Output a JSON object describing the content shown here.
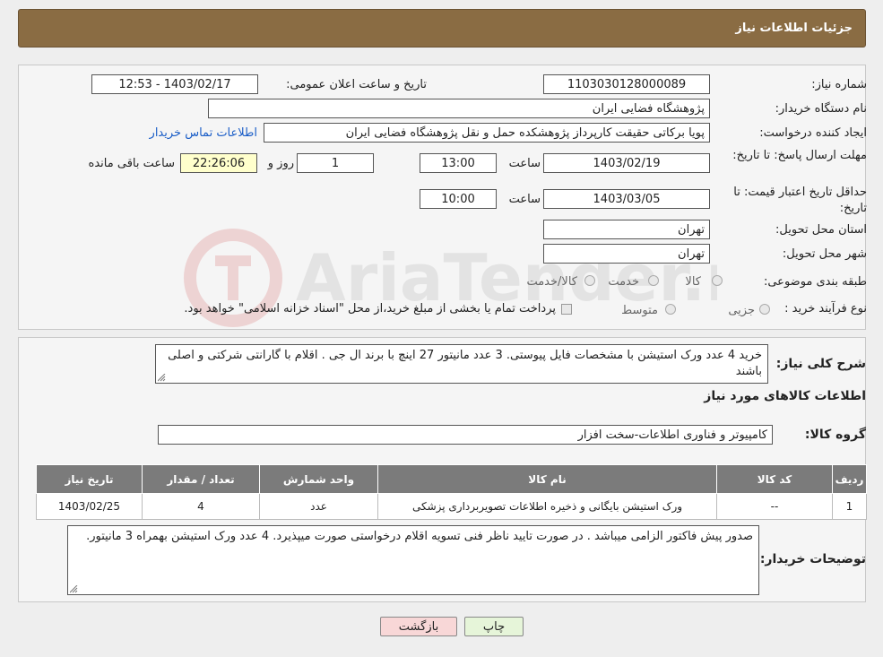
{
  "header": {
    "title": "جزئیات اطلاعات نیاز"
  },
  "form": {
    "need_number_label": "شماره نیاز:",
    "need_number": "1103030128000089",
    "announce_label": "تاریخ و ساعت اعلان عمومی:",
    "announce_value": "1403/02/17 - 12:53",
    "buyer_org_label": "نام دستگاه خریدار:",
    "buyer_org": "پژوهشگاه فضایی ایران",
    "creator_label": "ایجاد کننده درخواست:",
    "creator": "پویا برکاتی حقیقت کارپرداز پژوهشکده حمل و نقل پژوهشگاه فضایی ایران",
    "contact_link": "اطلاعات تماس خریدار",
    "deadline_label": "مهلت ارسال پاسخ: تا تاریخ:",
    "deadline_date": "1403/02/19",
    "time_label": "ساعت",
    "deadline_time": "13:00",
    "days_value": "1",
    "days_label": "روز و",
    "remaining_time": "22:26:06",
    "remaining_label": "ساعت باقی مانده",
    "validity_label": "حداقل تاریخ اعتبار قیمت: تا تاریخ:",
    "validity_date": "1403/03/05",
    "validity_time": "10:00",
    "province_label": "استان محل تحویل:",
    "province": "تهران",
    "city_label": "شهر محل تحویل:",
    "city": "تهران",
    "category_label": "طبقه بندی موضوعی:",
    "category_options": [
      "کالا",
      "خدمت",
      "کالا/خدمت"
    ],
    "process_label": "نوع فرآیند خرید :",
    "process_options": [
      "جزیی",
      "متوسط"
    ],
    "process_note": "پرداخت تمام یا بخشی از مبلغ خرید،از محل \"اسناد خزانه اسلامی\" خواهد بود."
  },
  "watermark": "AriaTender.neT",
  "description": {
    "label": "شرح کلی نیاز:",
    "text": "خرید 4 عدد ورک استیشن با مشخصات فایل پیوستی. 3 عدد مانیتور 27 اینچ با برند ال جی . اقلام با گارانتی شرکتی و اصلی باشند"
  },
  "goods": {
    "section_title": "اطلاعات کالاهای مورد نیاز",
    "group_label": "گروه کالا:",
    "group_value": "کامپیوتر و فناوری اطلاعات-سخت افزار",
    "columns": [
      "ردیف",
      "کد کالا",
      "نام کالا",
      "واحد شمارش",
      "تعداد / مقدار",
      "تاریخ نیاز"
    ],
    "rows": [
      [
        "1",
        "--",
        "ورک استیشن بایگانی و ذخیره اطلاعات تصویربرداری پزشکی",
        "عدد",
        "4",
        "1403/02/25"
      ]
    ]
  },
  "buyer_notes": {
    "label": "توضیحات خریدار:",
    "text": "صدور پیش فاکتور الزامی میباشد . در صورت تایید ناظر فنی تسویه اقلام درخواستی صورت میپذیرد. 4 عدد ورک استیشن بهمراه 3 مانیتور."
  },
  "buttons": {
    "print": "چاپ",
    "back": "بازگشت"
  },
  "colors": {
    "header": "#8a6c43",
    "back_button": "#f8d7d7",
    "print_button": "#e6f5d9",
    "remaining": "#ffffcc"
  }
}
